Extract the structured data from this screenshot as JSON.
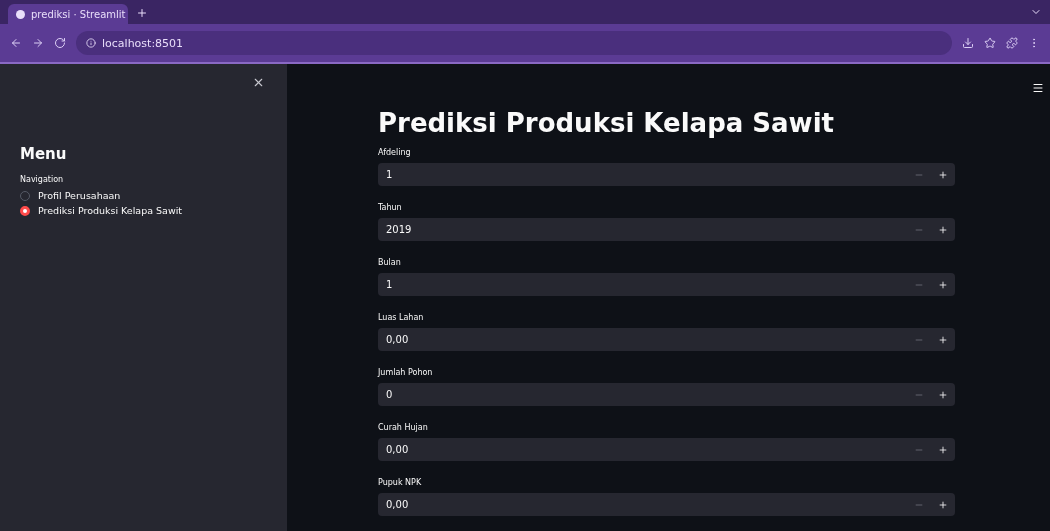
{
  "browser": {
    "tab": {
      "title": "prediksi · Streamlit",
      "selected": true
    },
    "address": "localhost:8501"
  },
  "sidebar": {
    "heading": "Menu",
    "radio_label": "Navigation",
    "options": [
      {
        "label": "Profil Perusahaan",
        "selected": false
      },
      {
        "label": "Prediksi Produksi Kelapa Sawit",
        "selected": true
      }
    ]
  },
  "main": {
    "title": "Prediksi Produksi Kelapa Sawit",
    "fields": [
      {
        "label": "Afdeling",
        "value": "1"
      },
      {
        "label": "Tahun",
        "value": "2019"
      },
      {
        "label": "Bulan",
        "value": "1"
      },
      {
        "label": "Luas Lahan",
        "value": "0,00"
      },
      {
        "label": "Jumlah Pohon",
        "value": "0"
      },
      {
        "label": "Curah Hujan",
        "value": "0,00"
      },
      {
        "label": "Pupuk NPK",
        "value": "0,00"
      }
    ]
  }
}
